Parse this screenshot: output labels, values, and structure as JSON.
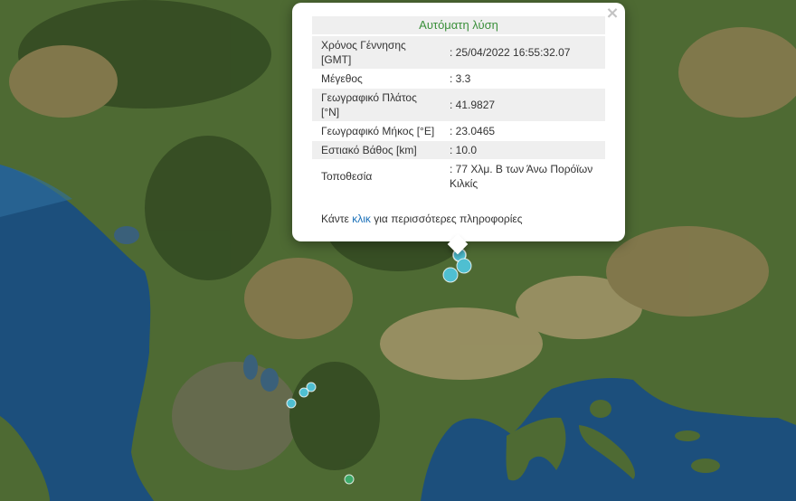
{
  "map": {
    "colors": {
      "sea_deep": "#1c4f7c",
      "sea_shelf": "#2f6fa0",
      "lake": "#3a607a",
      "land_green": "#4e6a33",
      "land_dark": "#334a22",
      "land_brown": "#8a7a50",
      "land_light": "#a3956a",
      "mountain": "#6a6a52"
    },
    "markers": [
      {
        "id": "selected",
        "color": "#4fbfd1",
        "size": "medium",
        "selected": true
      },
      {
        "id": "e2",
        "color": "#4fbfd1",
        "size": "large"
      },
      {
        "id": "e3",
        "color": "#4fbfd1",
        "size": "large"
      },
      {
        "id": "e4",
        "color": "#4fbfd1",
        "size": "small"
      },
      {
        "id": "e5",
        "color": "#4fbfd1",
        "size": "small"
      },
      {
        "id": "e6",
        "color": "#4fbfd1",
        "size": "small"
      },
      {
        "id": "e7",
        "color": "#3daa6a",
        "size": "small"
      }
    ]
  },
  "popup": {
    "title": "Αυτόματη λύση",
    "close_icon": "close-icon",
    "rows": [
      {
        "label": "Χρόνος Γέννησης [GMT]",
        "value": ": 25/04/2022 16:55:32.07"
      },
      {
        "label": "Μέγεθος",
        "value": ": 3.3"
      },
      {
        "label": "Γεωγραφικό Πλάτος [°N]",
        "value": ": 41.9827"
      },
      {
        "label": "Γεωγραφικό Μήκος [°E]",
        "value": ": 23.0465"
      },
      {
        "label": "Εστιακό Βάθος [km]",
        "value": ": 10.0"
      },
      {
        "label": "Τοποθεσία",
        "value": ": 77 Χλμ. Β των Άνω Πορόϊων Κιλκίς"
      }
    ],
    "more_prefix": "Κάντε",
    "more_link": "κλικ",
    "more_suffix": "για περισσότερες πληροφορίες"
  }
}
